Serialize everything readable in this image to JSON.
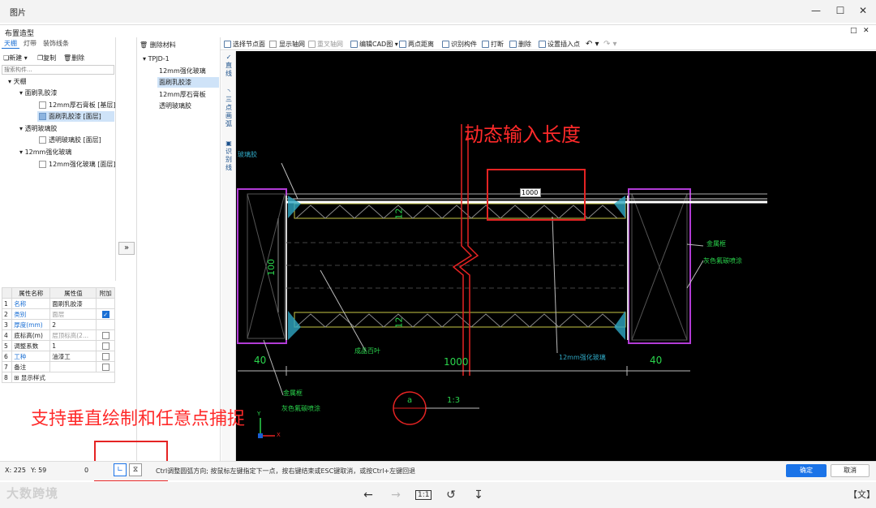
{
  "window": {
    "title": "图片"
  },
  "dialog": {
    "title": "布置造型"
  },
  "left_tabs": [
    "天棚",
    "灯带",
    "装饰线条"
  ],
  "left_toolbar": {
    "new": "新建",
    "copy": "复制",
    "delete": "删除"
  },
  "left_search": {
    "placeholder": "搜索构件..."
  },
  "tree": [
    {
      "label": "天棚"
    },
    {
      "label": "面刷乳胶漆"
    },
    {
      "label": "12mm厚石膏板 [基层]"
    },
    {
      "label": "面刷乳胶漆 [面层]"
    },
    {
      "label": "透明玻璃胶"
    },
    {
      "label": "透明玻璃胶 [面层]"
    },
    {
      "label": "12mm强化玻璃"
    },
    {
      "label": "12mm强化玻璃 [面层]"
    }
  ],
  "props": {
    "headers": [
      "属性名称",
      "属性值",
      "附加"
    ],
    "rows": [
      {
        "n": "1",
        "name": "名称",
        "value": "面刷乳胶漆"
      },
      {
        "n": "2",
        "name": "类别",
        "value": "面层"
      },
      {
        "n": "3",
        "name": "厚度(mm)",
        "value": "2"
      },
      {
        "n": "4",
        "name": "底标高(m)",
        "value": "层顶标高(2..."
      },
      {
        "n": "5",
        "name": "调整系数",
        "value": "1"
      },
      {
        "n": "6",
        "name": "工种",
        "value": "油漆工"
      },
      {
        "n": "7",
        "name": "备注",
        "value": ""
      },
      {
        "n": "8",
        "name": "显示样式",
        "value": ""
      }
    ]
  },
  "mid": {
    "delete_material": "删除材料",
    "root": "TPJD-1",
    "items": [
      "12mm强化玻璃",
      "面刷乳胶漆",
      "12mm厚石膏板",
      "透明玻璃胶"
    ]
  },
  "toolbar": [
    "选择节点面",
    "显示轴网",
    "重叉轴网",
    "编辑CAD图",
    "两点距离",
    "识别构件",
    "打断",
    "删除",
    "设置插入点"
  ],
  "vtools": [
    "直线",
    "三点画弧",
    "识别线"
  ],
  "canvas": {
    "input_value": "1000",
    "labels": {
      "glass_glue": "玻璃胶",
      "dim_12_top": "12",
      "dim_12_bottom": "12",
      "dim_100": "100",
      "dim_40_left": "40",
      "dim_40_right": "40",
      "dim_1000": "1000",
      "metal_frame_right": "金属框",
      "fluoro_right": "灰色氟碳喷涂",
      "blinds": "成品百叶",
      "glass_12mm": "12mm强化玻璃",
      "metal_frame_left": "金属框",
      "fluoro_left": "灰色氟碳喷涂",
      "section": "a",
      "scale": "1:3",
      "axis_y": "Y",
      "axis_x": "X"
    }
  },
  "status": {
    "x_label": "X: 225",
    "y_label": "Y: 59",
    "zero": "0",
    "hint": "Ctrl调整圆弧方向; 按鼠标左键指定下一点，按右键结束或ESC键取消，或按Ctrl+左键回退",
    "ok": "确定",
    "cancel": "取消"
  },
  "annotations": {
    "dynamic_input": "动态输入长度",
    "vertical_snap": "支持垂直绘制和任意点捕捉"
  },
  "watermark": "大数跨境",
  "colors": {
    "accent": "#1a73e8",
    "annotation": "#ff2a2a"
  }
}
